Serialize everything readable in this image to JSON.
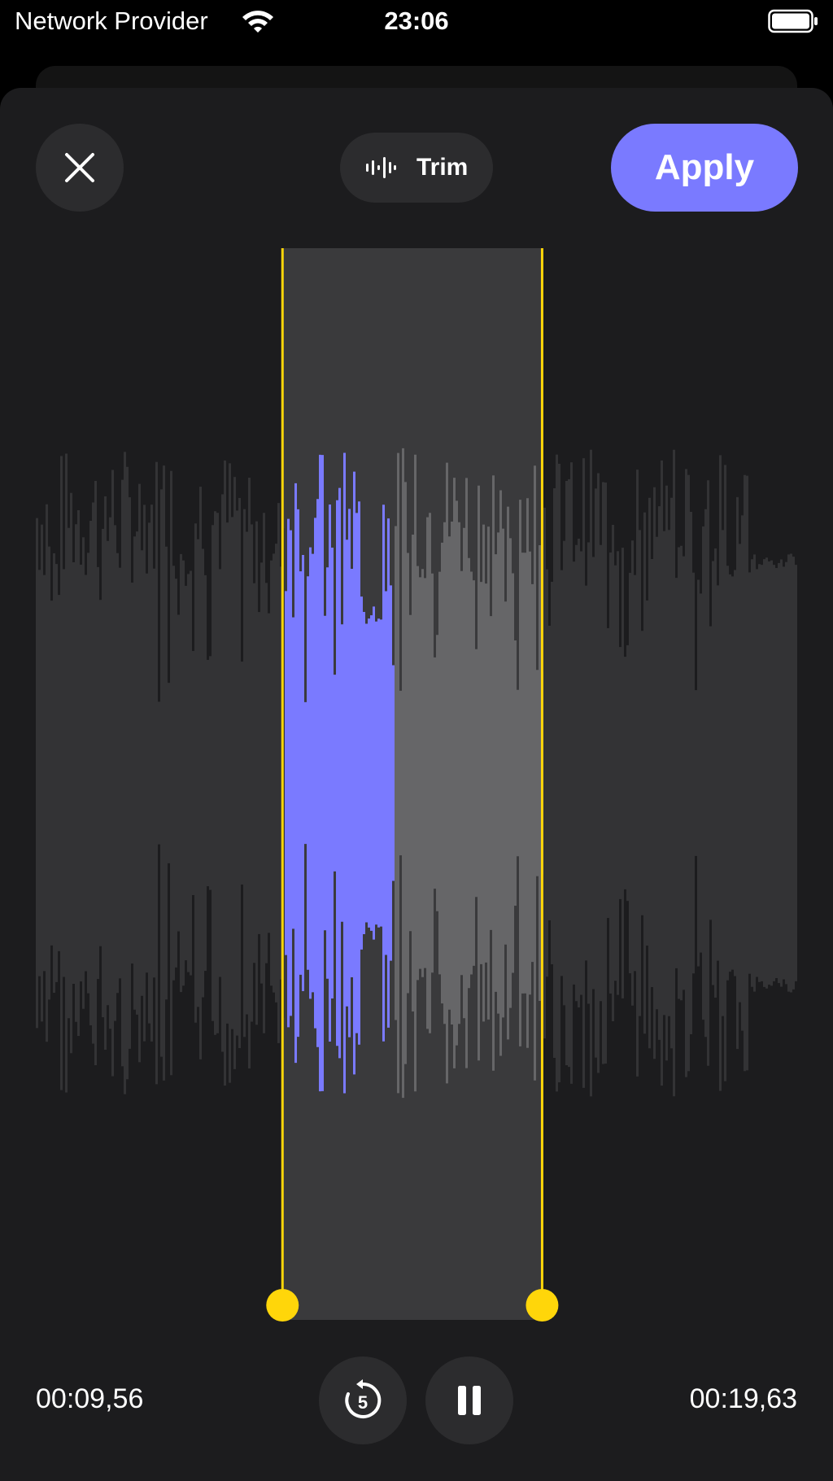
{
  "status_bar": {
    "carrier": "Network Provider",
    "time": "23:06"
  },
  "toolbar": {
    "close_icon": "close-icon",
    "mode_icon": "waveform-icon",
    "mode_label": "Trim",
    "apply_label": "Apply"
  },
  "editor": {
    "selection_start_fraction": 0.324,
    "selection_end_fraction": 0.665,
    "playhead_fraction": 0.47,
    "start_time": "00:09,56",
    "end_time": "00:19,63"
  },
  "playback": {
    "skip_icon": "rewind-5-icon",
    "skip_seconds": "5",
    "pause_icon": "pause-icon"
  },
  "colors": {
    "accent": "#7a7aff",
    "handle": "#ffd60a",
    "sheet_background": "#1c1c1e",
    "selection_background": "#3a3a3c",
    "waveform_dim": "#333335",
    "waveform_selected_unplayed": "#666668"
  }
}
